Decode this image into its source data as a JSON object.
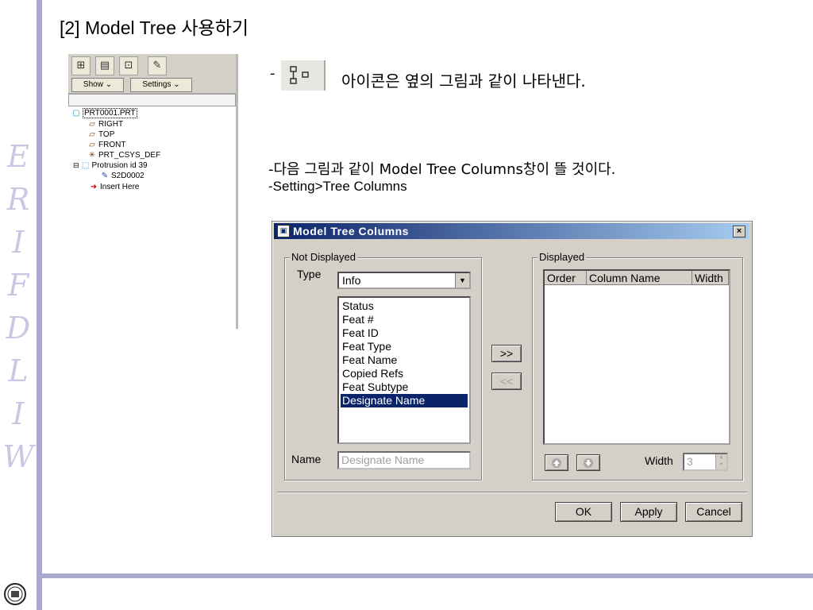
{
  "slide": {
    "title": "[2] Model Tree 사용하기",
    "brand_letters": [
      "E",
      "R",
      "I",
      "F",
      "D",
      "L",
      "I",
      "W"
    ]
  },
  "model_tree_panel": {
    "toolbar_icons": [
      "tree-icon",
      "layers-icon",
      "settings-icon",
      "filter-icon"
    ],
    "show_label": "Show ⌄",
    "settings_label": "Settings ⌄",
    "items": [
      {
        "label": "PRT0001.PRT",
        "icon": "part-icon"
      },
      {
        "label": "RIGHT",
        "icon": "datum-plane-icon"
      },
      {
        "label": "TOP",
        "icon": "datum-plane-icon"
      },
      {
        "label": "FRONT",
        "icon": "datum-plane-icon"
      },
      {
        "label": "PRT_CSYS_DEF",
        "icon": "csys-icon"
      },
      {
        "label": "Protrusion id 39",
        "icon": "protrusion-icon"
      },
      {
        "label": "S2D0002",
        "icon": "sketch-icon"
      },
      {
        "label": "Insert Here",
        "icon": "insert-arrow-icon"
      }
    ]
  },
  "notes": {
    "dash": "-",
    "icon_note": "아이콘은 옆의 그림과 같이 나타낸다.",
    "line2": "-다음 그림과 같이 Model Tree Columns창이 뜰 것이다.",
    "line3": "-Setting>Tree Columns"
  },
  "dialog": {
    "title": "Model Tree Columns",
    "close_label": "×",
    "not_displayed_label": "Not Displayed",
    "type_label": "Type",
    "type_value": "Info",
    "list_items": [
      "Status",
      "Feat #",
      "Feat ID",
      "Feat Type",
      "Feat Name",
      "Copied Refs",
      "Feat Subtype",
      "Designate Name"
    ],
    "selected_item": "Designate Name",
    "name_label": "Name",
    "name_value": "Designate Name",
    "add_label": ">>",
    "remove_label": "<<",
    "displayed_label": "Displayed",
    "columns": [
      "Order",
      "Column Name",
      "Width"
    ],
    "width_label": "Width",
    "width_value": "3",
    "ok_label": "OK",
    "apply_label": "Apply",
    "cancel_label": "Cancel"
  },
  "colors": {
    "accent_rule": "#a9a8cf",
    "title_bar": "#0a246a",
    "selection": "#0a246a"
  }
}
